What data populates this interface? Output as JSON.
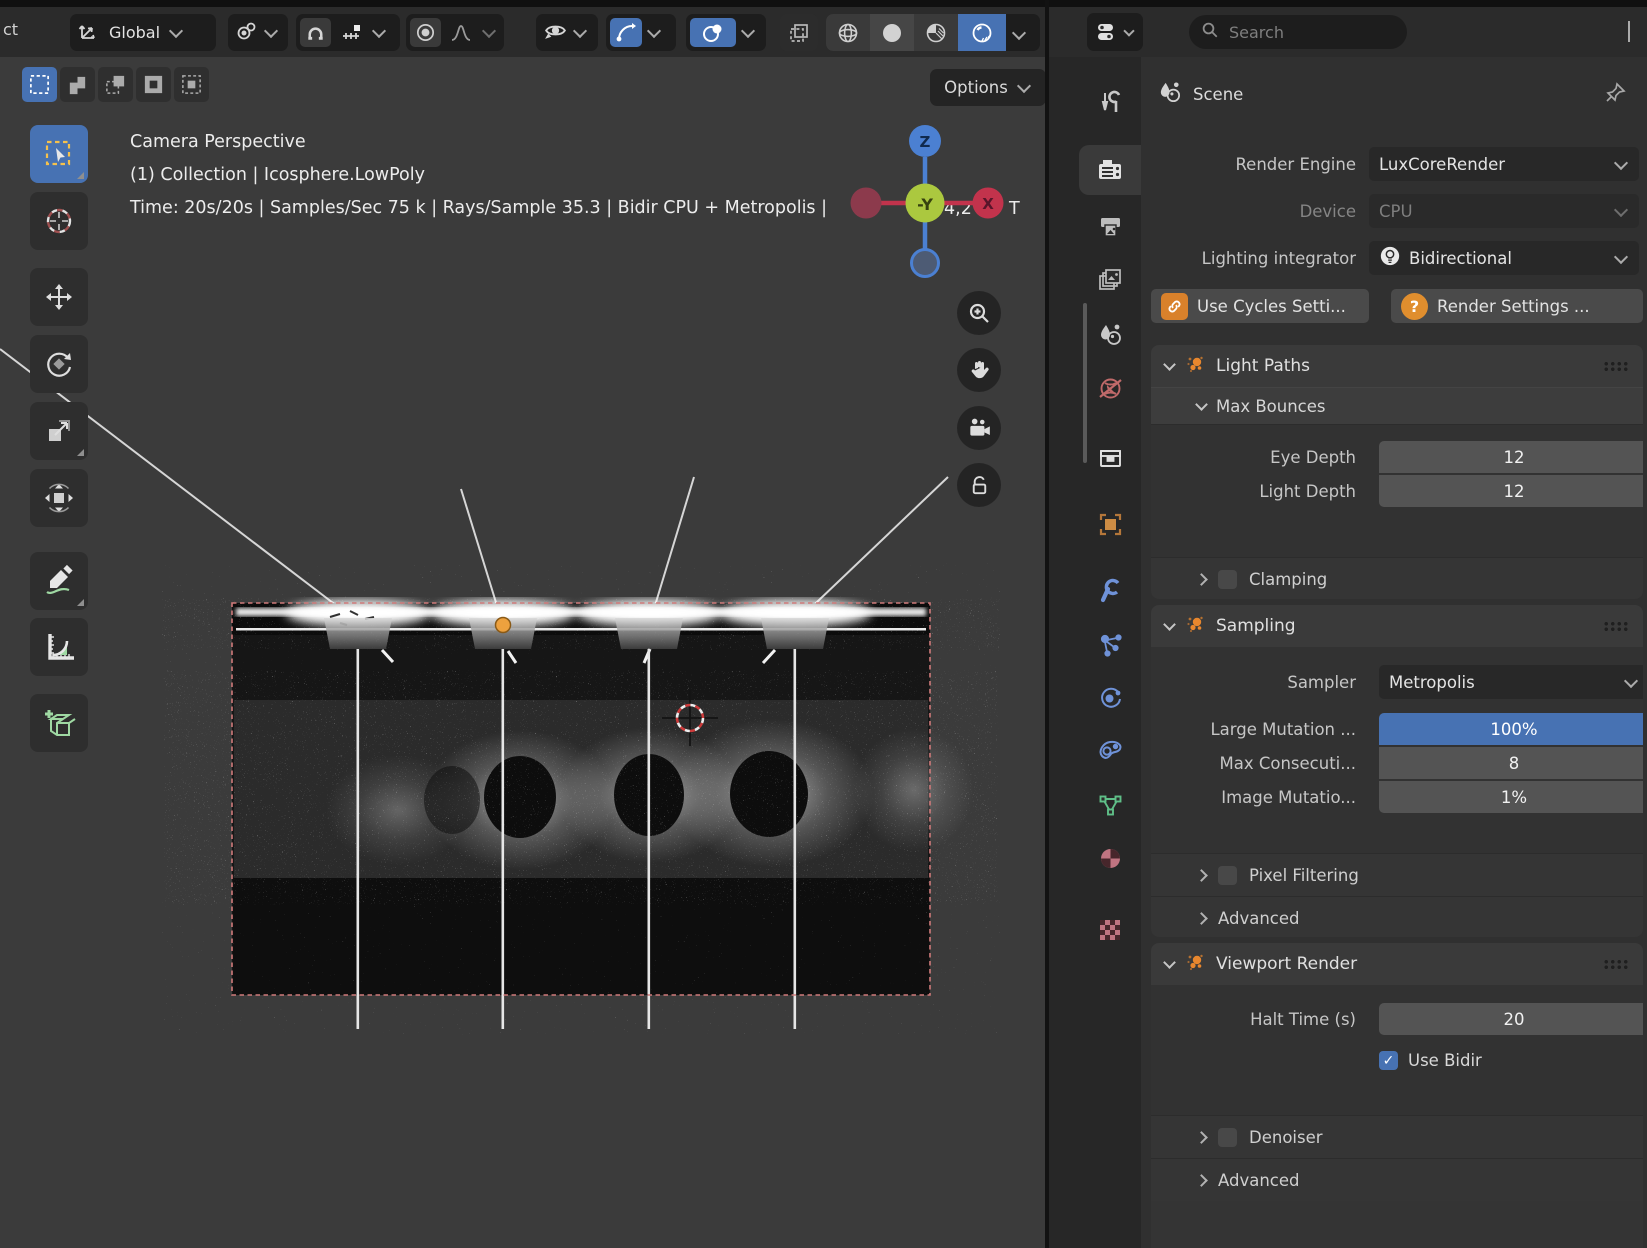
{
  "viewport": {
    "header": {
      "select_label": "ct",
      "orientation": "Global",
      "options_label": "Options"
    },
    "overlay": {
      "view_label": "Camera Perspective",
      "collection_info": "(1) Collection | Icosphere.LowPoly",
      "stats": "Time: 20s/20s | Samples/Sec 75 k | Rays/Sample 35.3 | Bidir CPU + Metropolis |",
      "stats_mid": "4,2",
      "stats_tail": "T"
    },
    "gizmo": {
      "z": "Z",
      "neg_y": "-Y",
      "x": "X"
    }
  },
  "properties": {
    "search_placeholder": "Search",
    "breadcrumb": "Scene",
    "render_engine": {
      "label": "Render Engine",
      "value": "LuxCoreRender"
    },
    "device": {
      "label": "Device",
      "value": "CPU"
    },
    "lighting_integrator": {
      "label": "Lighting integrator",
      "value": "Bidirectional"
    },
    "use_cycles_button": "Use Cycles Setti...",
    "render_settings_button": "Render Settings ...",
    "light_paths": {
      "title": "Light Paths",
      "max_bounces": "Max Bounces",
      "eye_depth": {
        "label": "Eye Depth",
        "value": "12"
      },
      "light_depth": {
        "label": "Light Depth",
        "value": "12"
      },
      "clamping": "Clamping"
    },
    "sampling": {
      "title": "Sampling",
      "sampler": {
        "label": "Sampler",
        "value": "Metropolis"
      },
      "large_mutation": {
        "label": "Large Mutation ...",
        "value": "100%"
      },
      "max_consecutive": {
        "label": "Max Consecuti...",
        "value": "8"
      },
      "image_mutation": {
        "label": "Image Mutatio...",
        "value": "1%"
      },
      "pixel_filtering": "Pixel Filtering",
      "advanced": "Advanced"
    },
    "viewport_render": {
      "title": "Viewport Render",
      "halt_time": {
        "label": "Halt Time (s)",
        "value": "20"
      },
      "use_bidir": "Use Bidir",
      "denoiser": "Denoiser",
      "advanced": "Advanced"
    }
  },
  "colors": {
    "accent_blue": "#4772b3",
    "icon_orange": "#e8872e",
    "camera_border_red": "#cf7a7a",
    "axis_z_blue": "#4b80d2",
    "axis_x_red": "#c2334c",
    "axis_neg_y_green": "#abc83f"
  }
}
